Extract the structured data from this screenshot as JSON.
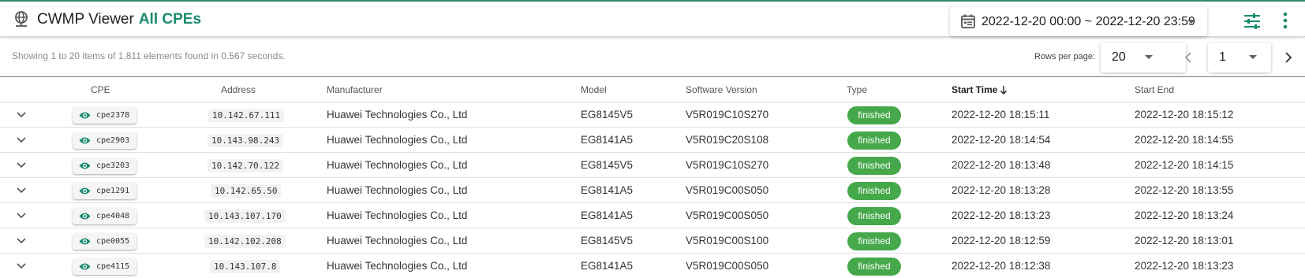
{
  "app": {
    "title": "CWMP Viewer",
    "subtitle": "All CPEs"
  },
  "date_range": "2022-12-20 00:00 ~ 2022-12-20 23:59",
  "summary": "Showing 1 to 20 items of 1,811 elements found in 0.567 seconds.",
  "pagination": {
    "rows_label": "Rows per page:",
    "rows_per_page": "20",
    "page": "1"
  },
  "columns": [
    "CPE",
    "Address",
    "Manufacturer",
    "Model",
    "Software Version",
    "Type",
    "Start Time",
    "Start End"
  ],
  "colors": {
    "accent": "#1a8a6e",
    "badge": "#45a84a"
  },
  "rows": [
    {
      "cpe": "cpe2378",
      "address": "10.142.67.111",
      "manufacturer": "Huawei Technologies Co., Ltd",
      "model": "EG8145V5",
      "software": "V5R019C10S270",
      "type": "finished",
      "start": "2022-12-20 18:15:11",
      "end": "2022-12-20 18:15:12"
    },
    {
      "cpe": "cpe2903",
      "address": "10.143.98.243",
      "manufacturer": "Huawei Technologies Co., Ltd",
      "model": "EG8141A5",
      "software": "V5R019C20S108",
      "type": "finished",
      "start": "2022-12-20 18:14:54",
      "end": "2022-12-20 18:14:55"
    },
    {
      "cpe": "cpe3203",
      "address": "10.142.70.122",
      "manufacturer": "Huawei Technologies Co., Ltd",
      "model": "EG8145V5",
      "software": "V5R019C10S270",
      "type": "finished",
      "start": "2022-12-20 18:13:48",
      "end": "2022-12-20 18:14:15"
    },
    {
      "cpe": "cpe1291",
      "address": "10.142.65.50",
      "manufacturer": "Huawei Technologies Co., Ltd",
      "model": "EG8141A5",
      "software": "V5R019C00S050",
      "type": "finished",
      "start": "2022-12-20 18:13:28",
      "end": "2022-12-20 18:13:55"
    },
    {
      "cpe": "cpe4048",
      "address": "10.143.107.170",
      "manufacturer": "Huawei Technologies Co., Ltd",
      "model": "EG8141A5",
      "software": "V5R019C00S050",
      "type": "finished",
      "start": "2022-12-20 18:13:23",
      "end": "2022-12-20 18:13:24"
    },
    {
      "cpe": "cpe0055",
      "address": "10.142.102.208",
      "manufacturer": "Huawei Technologies Co., Ltd",
      "model": "EG8145V5",
      "software": "V5R019C00S100",
      "type": "finished",
      "start": "2022-12-20 18:12:59",
      "end": "2022-12-20 18:13:01"
    },
    {
      "cpe": "cpe4115",
      "address": "10.143.107.8",
      "manufacturer": "Huawei Technologies Co., Ltd",
      "model": "EG8141A5",
      "software": "V5R019C00S050",
      "type": "finished",
      "start": "2022-12-20 18:12:38",
      "end": "2022-12-20 18:13:23"
    }
  ]
}
